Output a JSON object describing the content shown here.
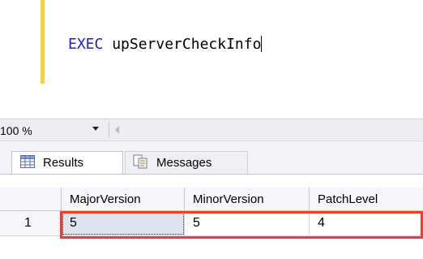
{
  "editor": {
    "keyword": "EXEC",
    "procedure": " upServerCheckInfo"
  },
  "zoom": {
    "value": "100 %"
  },
  "tabs": [
    {
      "label": "Results",
      "icon": "grid-icon"
    },
    {
      "label": "Messages",
      "icon": "document-icon"
    }
  ],
  "grid": {
    "columns": [
      "MajorVersion",
      "MinorVersion",
      "PatchLevel"
    ],
    "rows": [
      {
        "row_number": "1",
        "cells": [
          "5",
          "5",
          "4"
        ]
      }
    ]
  },
  "colors": {
    "keyword": "#1f1fd6",
    "highlight": "#e8412f",
    "gutter_marker": "#f2d43d"
  }
}
